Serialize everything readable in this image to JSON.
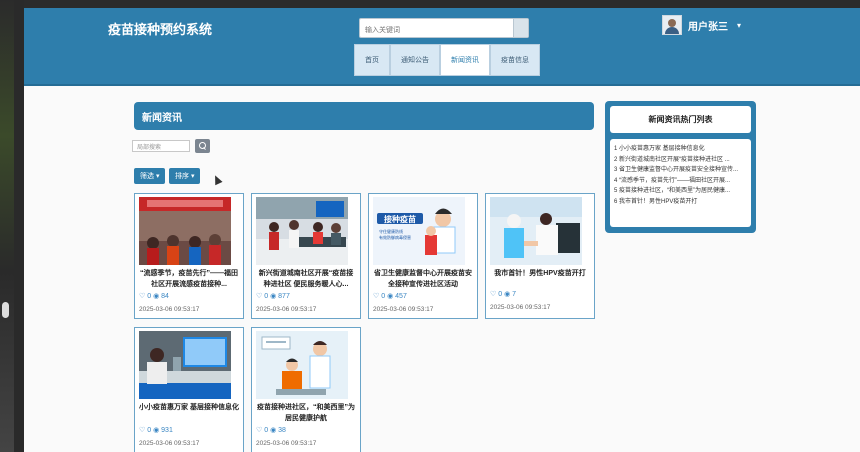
{
  "brand": "疫苗接种预约系统",
  "search": {
    "placeholder": "输入关键词"
  },
  "user": {
    "name": "用户张三",
    "caret": "▾"
  },
  "nav": [
    "首页",
    "通知公告",
    "新闻资讯",
    "疫苗信息"
  ],
  "nav_active": 2,
  "section_title": "新闻资讯",
  "list_search_placeholder": "局部搜索",
  "filter_btn": "筛选 ▾",
  "sort_btn": "排序 ▾",
  "cards": [
    {
      "title": "“流感季节，疫苗先行”——福田社区开展流感疫苗接种...",
      "likes": "0",
      "views": "84",
      "date": "2025-03-06 09:53:17"
    },
    {
      "title": "新兴街道城南社区开展“疫苗接种进社区 便民服务暖人心...",
      "likes": "0",
      "views": "877",
      "date": "2025-03-06 09:53:17"
    },
    {
      "title": "省卫生健康监督中心开展疫苗安全接种宣传进社区活动",
      "likes": "0",
      "views": "457",
      "date": "2025-03-06 09:53:17"
    },
    {
      "title": "我市首针！男性HPV疫苗开打",
      "likes": "0",
      "views": "7",
      "date": "2025-03-06 09:53:17"
    },
    {
      "title": "小小疫苗惠万家 基层接种信息化",
      "likes": "0",
      "views": "931",
      "date": "2025-03-06 09:53:17"
    },
    {
      "title": "疫苗接种进社区，“和美西里”为居民健康护航",
      "likes": "0",
      "views": "38",
      "date": "2025-03-06 09:53:17"
    }
  ],
  "hot": {
    "title": "新闻资讯热门列表",
    "items": [
      "1  小小疫苗惠万家 基层接种信息化",
      "2  新兴街道城南社区开展“疫苗接种进社区 ...",
      "3  省卫生健康监督中心开展疫苗安全接种宣传...",
      "4  “流感季节，疫苗先行”——福田社区开展...",
      "5  疫苗接种进社区，“和美西里”为居民健康...",
      "6  我市首针！男性HPV疫苗开打"
    ]
  },
  "poster_text": {
    "big": "接种疫苗",
    "line1": "守住健康防线",
    "line2": "有效防御病毒侵害"
  },
  "icons": {
    "like": "thumbs-up-icon",
    "view": "eye-icon",
    "search": "search-icon"
  },
  "colors": {
    "primary": "#2e7eac",
    "accent_text": "#3a86c3"
  }
}
